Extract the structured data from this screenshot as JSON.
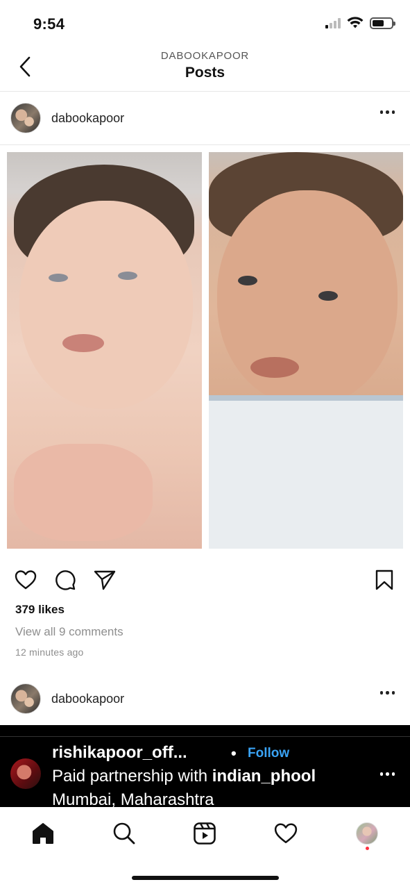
{
  "status_bar": {
    "time": "9:54",
    "signal_bars_on": 1,
    "battery_level": 0.6
  },
  "header": {
    "subtitle": "DABOOKAPOOR",
    "title": "Posts",
    "back_icon": "chevron-left-icon"
  },
  "post": {
    "username": "dabookapoor",
    "more_icon": "more-horizontal-icon",
    "image_description_icons": [
      "photo-left",
      "photo-right"
    ],
    "actions": {
      "like_icon": "heart-icon",
      "comment_icon": "comment-icon",
      "share_icon": "send-icon",
      "save_icon": "bookmark-icon"
    },
    "likes": "379 likes",
    "comments_link": "View all 9 comments",
    "timestamp": "12 minutes ago"
  },
  "next_post": {
    "username": "dabookapoor"
  },
  "sponsored_post": {
    "username": "rishikapoor_off...",
    "separator": "•",
    "follow_label": "Follow",
    "partnership_prefix": "Paid partnership with ",
    "partner": "indian_phool",
    "location": "Mumbai, Maharashtra",
    "colors": {
      "follow": "#3aa3f5",
      "background": "#000000"
    }
  },
  "tab_bar": {
    "items": [
      "home-icon",
      "search-icon",
      "reels-icon",
      "heart-icon",
      "profile-avatar"
    ]
  },
  "colors": {
    "notification_dot": "#ff3040",
    "muted_text": "#8e8e8e"
  }
}
